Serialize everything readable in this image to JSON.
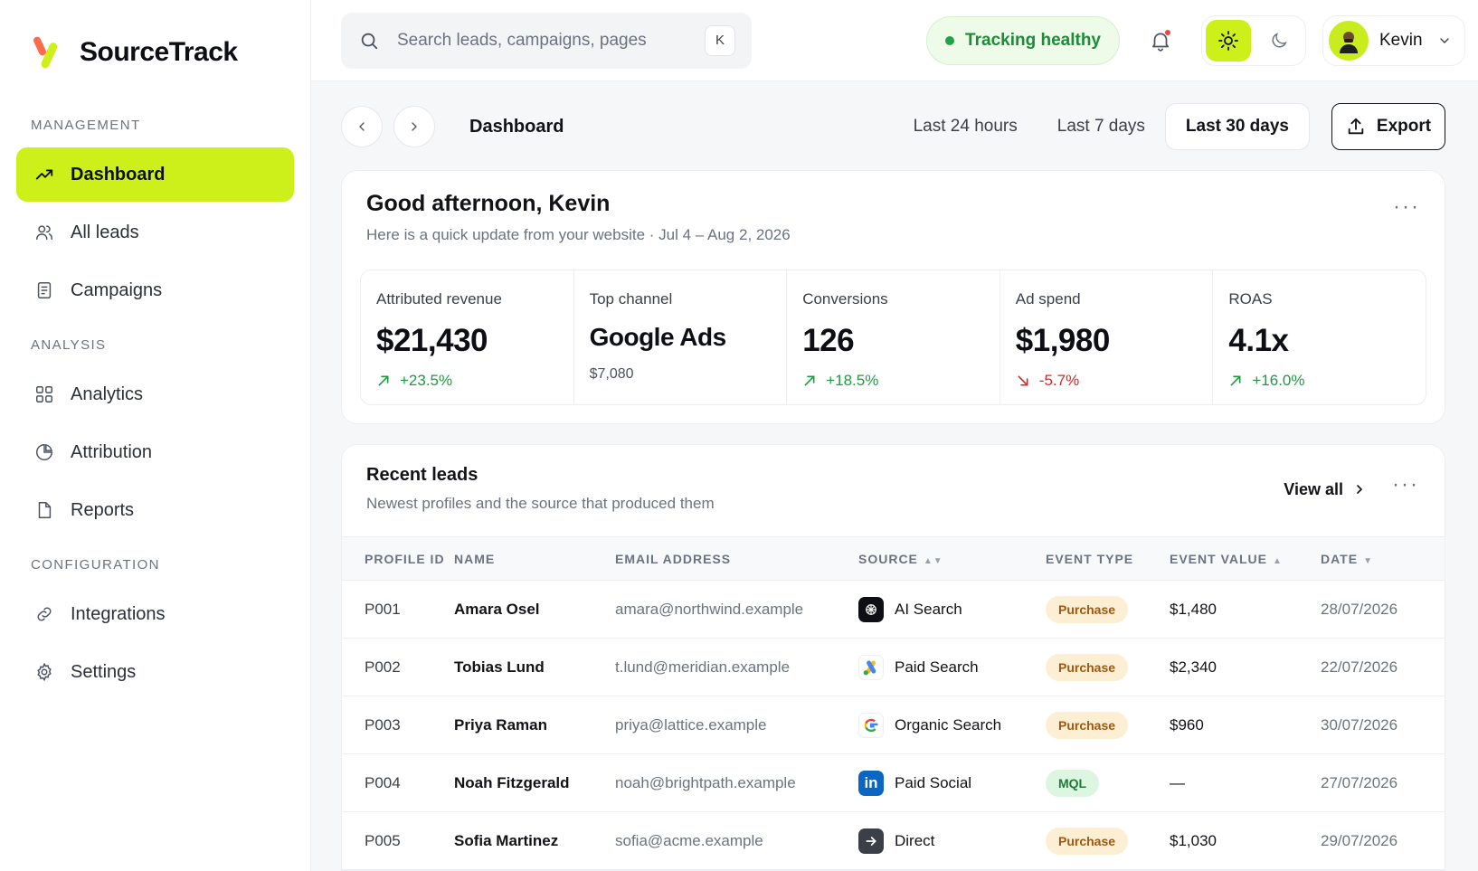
{
  "brand": {
    "name": "SourceTrack"
  },
  "sidebar": {
    "sections": [
      {
        "label": "MANAGEMENT",
        "items": [
          {
            "label": "Dashboard",
            "icon": "trending-up-icon",
            "active": true
          },
          {
            "label": "All leads",
            "icon": "users-icon"
          },
          {
            "label": "Campaigns",
            "icon": "document-list-icon"
          }
        ]
      },
      {
        "label": "ANALYSIS",
        "items": [
          {
            "label": "Analytics",
            "icon": "grid-icon"
          },
          {
            "label": "Attribution",
            "icon": "pie-icon"
          },
          {
            "label": "Reports",
            "icon": "file-icon"
          }
        ]
      },
      {
        "label": "CONFIGURATION",
        "items": [
          {
            "label": "Integrations",
            "icon": "link-icon"
          },
          {
            "label": "Settings",
            "icon": "gear-icon"
          }
        ]
      }
    ]
  },
  "topbar": {
    "search_placeholder": "Search leads, campaigns, pages",
    "search_shortcut": "K",
    "status": "Tracking healthy",
    "user_name": "Kevin"
  },
  "toolbar": {
    "breadcrumb": "Dashboard",
    "ranges": [
      "Last 24 hours",
      "Last 7 days",
      "Last 30 days"
    ],
    "active_range": "Last 30 days",
    "export_label": "Export"
  },
  "summary": {
    "greeting": "Good afternoon, Kevin",
    "subtitle": "Here is a quick update from your website · Jul 4 – Aug 2, 2026",
    "stats": [
      {
        "label": "Attributed revenue",
        "value": "$21,430",
        "delta": "+23.5%",
        "direction": "up"
      },
      {
        "label": "Top channel",
        "value": "Google Ads",
        "note": "$7,080"
      },
      {
        "label": "Conversions",
        "value": "126",
        "delta": "+18.5%",
        "direction": "up"
      },
      {
        "label": "Ad spend",
        "value": "$1,980",
        "delta": "-5.7%",
        "direction": "down"
      },
      {
        "label": "ROAS",
        "value": "4.1x",
        "delta": "+16.0%",
        "direction": "up"
      }
    ]
  },
  "leads": {
    "title": "Recent leads",
    "subtitle": "Newest profiles and the source that produced them",
    "view_all": "View all",
    "columns": [
      "PROFILE ID",
      "NAME",
      "EMAIL ADDRESS",
      "SOURCE",
      "EVENT TYPE",
      "EVENT VALUE",
      "DATE"
    ],
    "rows": [
      {
        "id": "P001",
        "name": "Amara Osel",
        "email": "amara@northwind.example",
        "source": "AI Search",
        "source_icon": "ai-search-icon",
        "event": "Purchase",
        "value": "$1,480",
        "date": "28/07/2026"
      },
      {
        "id": "P002",
        "name": "Tobias Lund",
        "email": "t.lund@meridian.example",
        "source": "Paid Search",
        "source_icon": "google-ads-icon",
        "event": "Purchase",
        "value": "$2,340",
        "date": "22/07/2026"
      },
      {
        "id": "P003",
        "name": "Priya Raman",
        "email": "priya@lattice.example",
        "source": "Organic Search",
        "source_icon": "google-icon",
        "event": "Purchase",
        "value": "$960",
        "date": "30/07/2026"
      },
      {
        "id": "P004",
        "name": "Noah Fitzgerald",
        "email": "noah@brightpath.example",
        "source": "Paid Social",
        "source_icon": "linkedin-icon",
        "event": "MQL",
        "value": "—",
        "date": "27/07/2026"
      },
      {
        "id": "P005",
        "name": "Sofia Martinez",
        "email": "sofia@acme.example",
        "source": "Direct",
        "source_icon": "direct-arrow-icon",
        "event": "Purchase",
        "value": "$1,030",
        "date": "29/07/2026"
      }
    ]
  },
  "colors": {
    "accent": "#cdf01a",
    "up": "#1f9a3f",
    "down": "#e02424"
  }
}
